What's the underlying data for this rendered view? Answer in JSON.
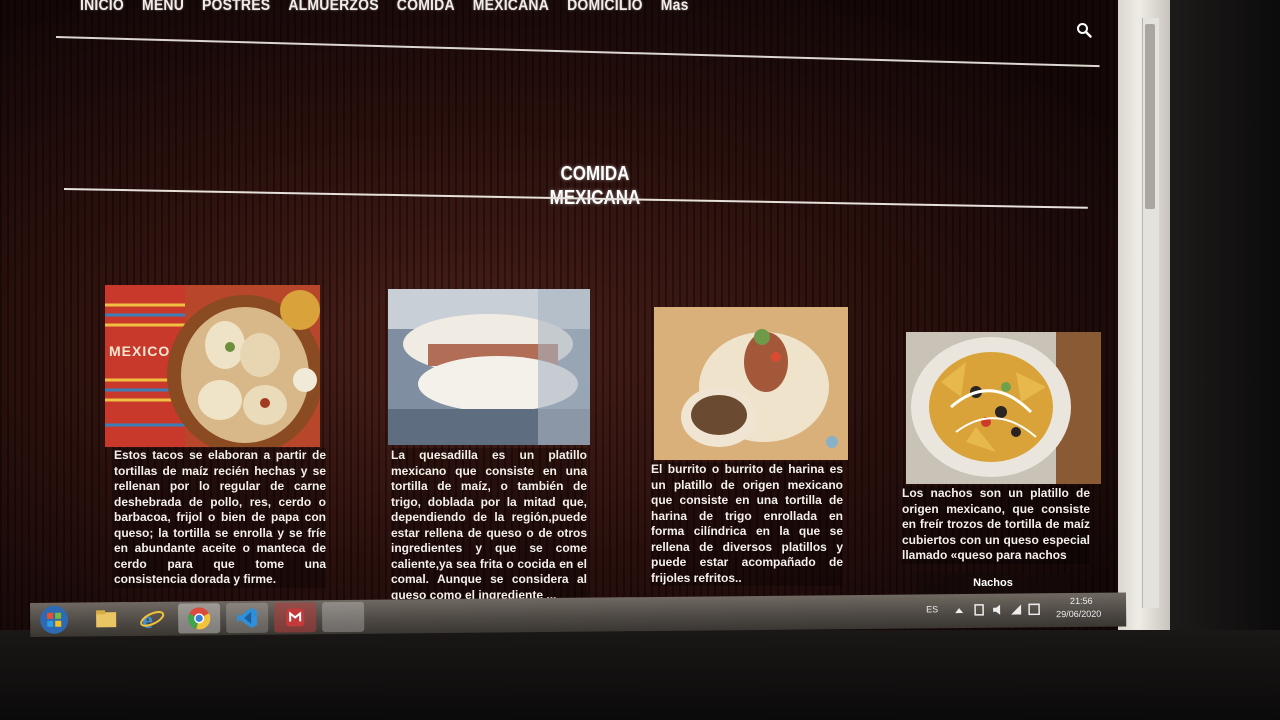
{
  "nav": {
    "items": [
      "INICIO",
      "MENU",
      "POSTRES",
      "ALMUERZOS",
      "COMIDA",
      "MEXICANA",
      "DOMICILIO",
      "Mas"
    ]
  },
  "page_title": "COMIDA MEXICANA",
  "cards": [
    {
      "image_label": "MEXICO",
      "text": "Estos tacos se elaboran a partir de tortillas de maíz recién hechas y se rellenan por lo regular de carne deshebrada de pollo, res, cerdo o barbacoa, frijol o bien de papa con queso; la tortilla se enrolla y se fríe en abundante aceite o manteca de cerdo para que tome una consistencia dorada y firme."
    },
    {
      "text": "La quesadilla es un platillo mexicano que consiste en una tortilla de maíz, o también de trigo, doblada por la mitad que, dependiendo de la región,puede estar rellena de queso o de otros ingredientes y que se come caliente,ya sea frita o cocida en el comal. Aunque se considera al queso como el ingrediente ..."
    },
    {
      "text": "El burrito o burrito de harina es un platillo de origen mexicano que consiste en una tortilla de harina de trigo enrollada en forma cilíndrica en la que se rellena de diversos platillos y puede estar acompañado de frijoles refritos.."
    },
    {
      "text": "Los nachos son un platillo de origen mexicano, que consiste en freír trozos de tortilla de maíz cubiertos con un queso especial llamado «queso para nachos",
      "caption": "Nachos"
    }
  ],
  "taskbar": {
    "language": "ES",
    "time": "21:56",
    "date": "29/06/2020"
  },
  "colors": {
    "background": "#2a100d",
    "text": "#f4f0ea",
    "rule": "#e6e1da"
  }
}
